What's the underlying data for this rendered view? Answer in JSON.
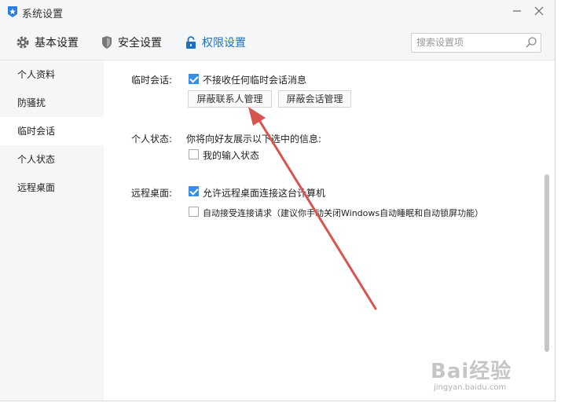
{
  "window": {
    "title": "系统设置",
    "minimize_icon": "minimize-icon",
    "close_icon": "close-icon"
  },
  "tabs": [
    {
      "label": "基本设置",
      "icon": "gear-icon"
    },
    {
      "label": "安全设置",
      "icon": "shield-icon"
    },
    {
      "label": "权限设置",
      "icon": "lock-icon",
      "active": true
    }
  ],
  "search": {
    "placeholder": "搜索设置项",
    "icon": "search-icon"
  },
  "sidebar": {
    "items": [
      {
        "label": "个人资料"
      },
      {
        "label": "防骚扰"
      },
      {
        "label": "临时会话",
        "active": true
      },
      {
        "label": "个人状态"
      },
      {
        "label": "远程桌面"
      }
    ]
  },
  "temp_session": {
    "label": "临时会话:",
    "checkbox_label": "不接收任何临时会话消息",
    "checked": true,
    "block_contacts_button": "屏蔽联系人管理",
    "block_session_button": "屏蔽会话管理"
  },
  "personal_status": {
    "label": "个人状态:",
    "description": "你将向好友展示以下选中的信息:",
    "checkbox_label": "我的输入状态",
    "checked": false
  },
  "remote_desktop": {
    "label": "远程桌面:",
    "allow_label": "允许远程桌面连接这台计算机",
    "allow_checked": true,
    "auto_accept_label": "自动接受连接请求（建议你手动关闭Windows自动睡眠和自动锁屏功能）",
    "auto_accept_checked": false
  },
  "colors": {
    "accent": "#1e6fc8",
    "checkbox": "#3a8ee6",
    "arrow": "#d9534f"
  },
  "watermark": {
    "text": "Bai经验",
    "url": "jingyan.baidu.com"
  }
}
